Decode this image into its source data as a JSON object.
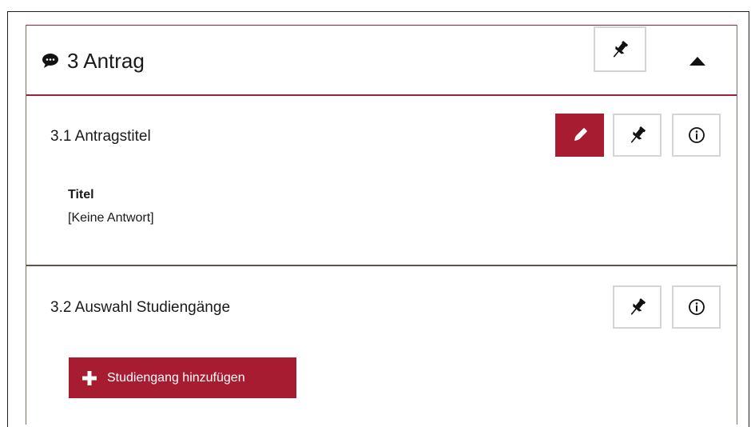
{
  "section": {
    "number_title": "3 Antrag",
    "icons": {
      "header": "chat-bubble-icon",
      "pin": "pin-icon",
      "collapse": "caret-up-icon"
    }
  },
  "subsections": [
    {
      "title": "3.1 Antragstitel",
      "actions": [
        "pencil-icon",
        "pin-icon",
        "info-icon"
      ],
      "fields": [
        {
          "label": "Titel",
          "value": "[Keine Antwort]"
        }
      ]
    },
    {
      "title": "3.2 Auswahl Studiengänge",
      "actions": [
        "pin-icon",
        "info-icon"
      ],
      "add_button": "Studiengang hinzufügen"
    }
  ],
  "colors": {
    "accent": "#a81c32",
    "border_button": "#d5d5d5",
    "divider": "#5f5548"
  }
}
